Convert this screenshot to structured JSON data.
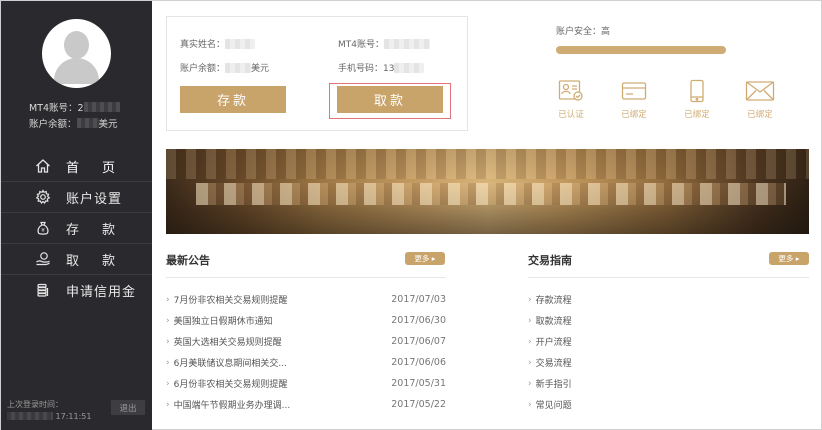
{
  "sidebar": {
    "mt4_label": "MT4账号：2",
    "balance_label": "账户余额：",
    "balance_unit": "美元",
    "nav": [
      {
        "icon": "home-icon",
        "label": "首页"
      },
      {
        "icon": "gear-icon",
        "label": "账户设置"
      },
      {
        "icon": "money-bag-icon",
        "label": "存款"
      },
      {
        "icon": "hand-coin-icon",
        "label": "取款"
      },
      {
        "icon": "coin-stack-icon",
        "label": "申请信用金"
      }
    ],
    "last_login_label": "上次登录时间：",
    "last_login_time": "17:11:51",
    "logout_label": "退出"
  },
  "account": {
    "real_name_label": "真实姓名：",
    "mt4_label": "MT4账号：",
    "balance_label": "账户余额：",
    "balance_unit": "美元",
    "phone_label": "手机号码：",
    "phone_prefix": "13",
    "deposit_button": "存款",
    "withdraw_button": "取款"
  },
  "security": {
    "label": "账户安全：高",
    "level": 1.0,
    "items": [
      {
        "icon": "id-card-icon",
        "label": "已认证"
      },
      {
        "icon": "bank-card-icon",
        "label": "已绑定"
      },
      {
        "icon": "phone-icon",
        "label": "已绑定"
      },
      {
        "icon": "envelope-icon",
        "label": "已绑定"
      }
    ]
  },
  "notices": {
    "title": "最新公告",
    "more_label": "更多",
    "items": [
      {
        "text": "7月份非农相关交易规则提醒",
        "date": "2017/07/03"
      },
      {
        "text": "美国独立日假期休市通知",
        "date": "2017/06/30"
      },
      {
        "text": "英国大选相关交易规则提醒",
        "date": "2017/06/07"
      },
      {
        "text": "6月美联储议息期间相关交...",
        "date": "2017/06/06"
      },
      {
        "text": "6月份非农相关交易规则提醒",
        "date": "2017/05/31"
      },
      {
        "text": "中国端午节假期业务办理调...",
        "date": "2017/05/22"
      }
    ]
  },
  "guide": {
    "title": "交易指南",
    "more_label": "更多",
    "items": [
      {
        "text": "存款流程"
      },
      {
        "text": "取款流程"
      },
      {
        "text": "开户流程"
      },
      {
        "text": "交易流程"
      },
      {
        "text": "新手指引"
      },
      {
        "text": "常见问题"
      }
    ]
  },
  "colors": {
    "sidebar_bg": "#2a2a2e",
    "accent_gold": "#c9a46a",
    "highlight_red": "#e0747a"
  }
}
